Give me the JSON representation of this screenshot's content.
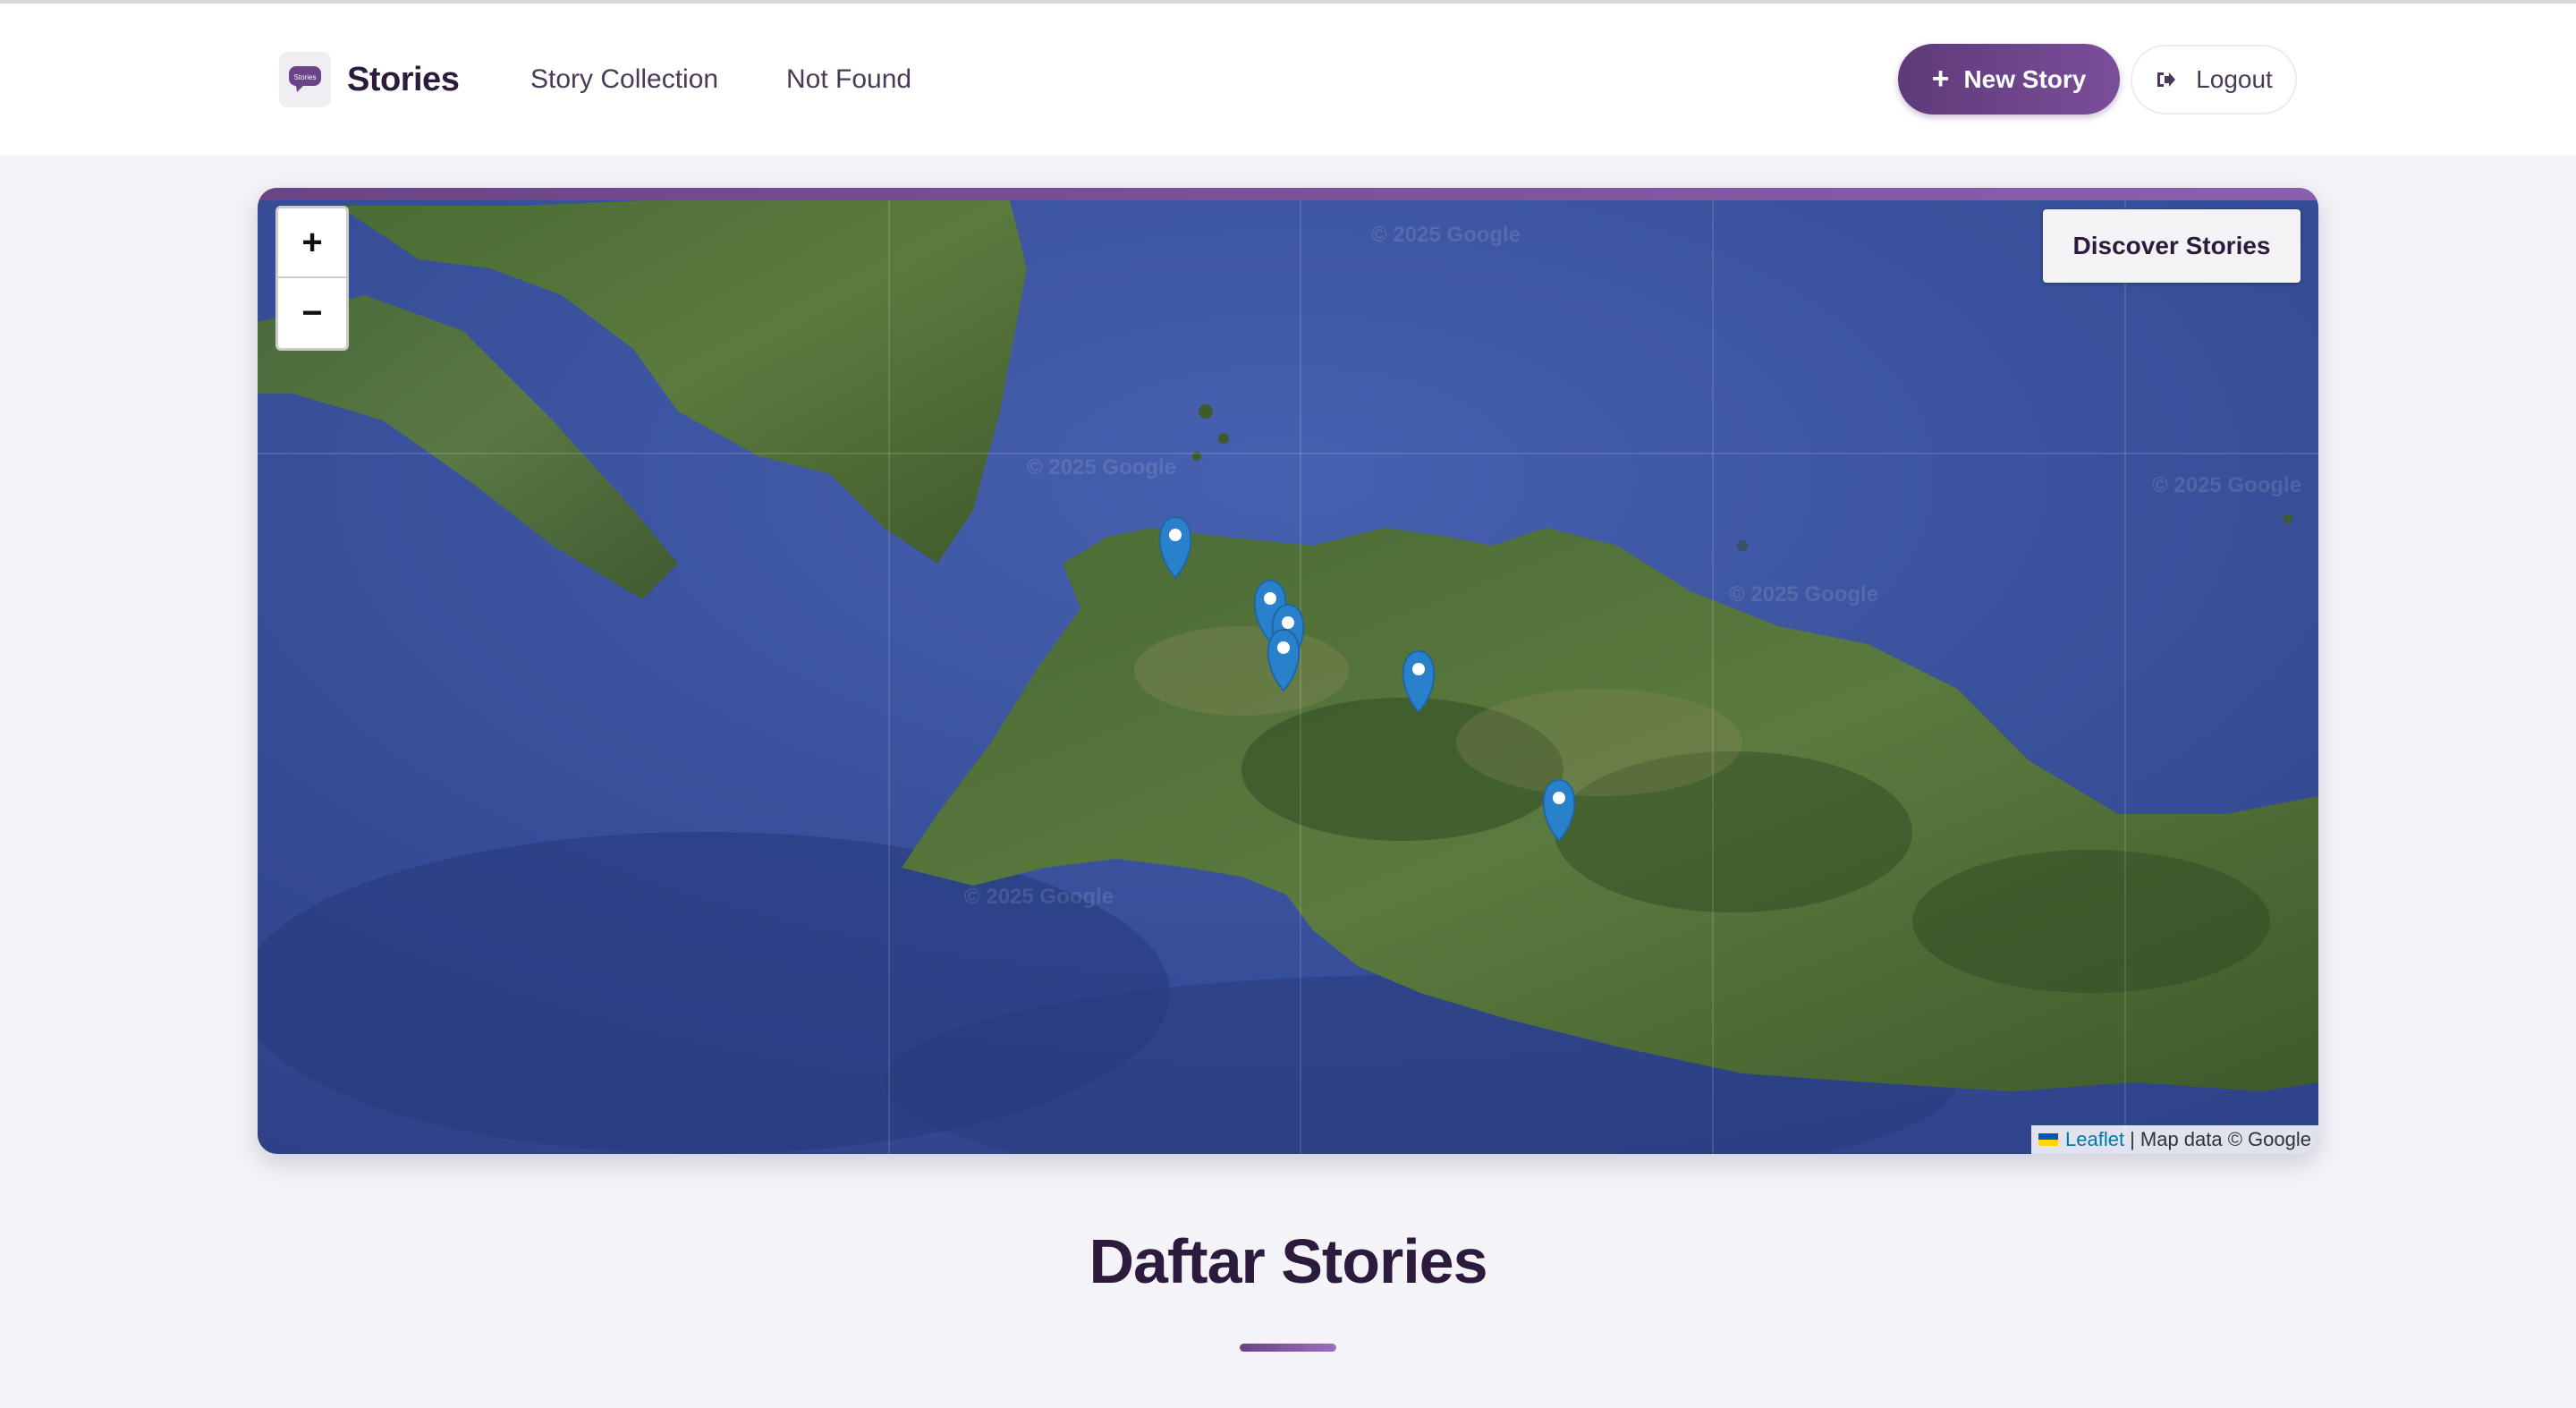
{
  "brand": {
    "name": "Stories",
    "logo_text": "Stories"
  },
  "nav": {
    "links": [
      "Story Collection",
      "Not Found"
    ]
  },
  "actions": {
    "new_story": "New Story",
    "logout": "Logout"
  },
  "map": {
    "zoom_in": "+",
    "zoom_out": "−",
    "layer_label": "Discover Stories",
    "attribution": {
      "leaflet": "Leaflet",
      "text": "| Map data © Google"
    },
    "watermark": "© 2025 Google",
    "markers_count_visible": 6
  },
  "section": {
    "title": "Daftar Stories"
  },
  "colors": {
    "accent": "#6a4487",
    "marker": "#2a81cb",
    "sea": "#3b56a3",
    "land": "#3d5a2c"
  }
}
